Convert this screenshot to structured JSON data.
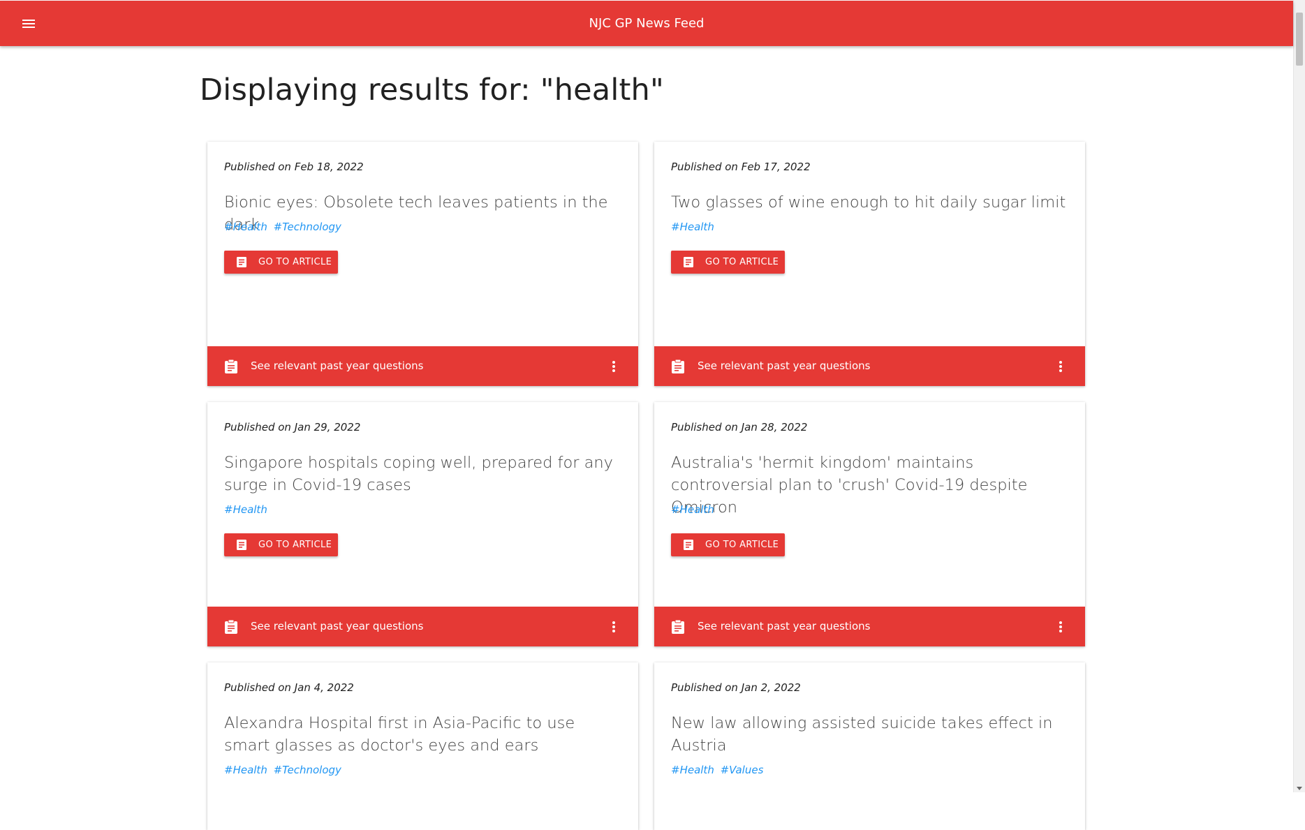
{
  "colors": {
    "primary": "#e53935",
    "tag": "#2196f3",
    "heading": "#212121"
  },
  "appbar": {
    "title": "NJC GP News Feed",
    "menu_icon": "menu-icon"
  },
  "page": {
    "heading": "Displaying results for: \"health\""
  },
  "common": {
    "go_label": "GO TO ARTICLE",
    "footer_label": "See relevant past year questions",
    "article_icon": "article-icon",
    "clipboard_icon": "clipboard-icon",
    "more_icon": "more-vert-icon"
  },
  "articles": [
    {
      "date": "Published on Feb 18, 2022",
      "title": "Bionic eyes: Obsolete tech leaves patients in the dark",
      "tags": [
        "#Health",
        "#Technology"
      ]
    },
    {
      "date": "Published on Feb 17, 2022",
      "title": "Two glasses of wine enough to hit daily sugar limit",
      "tags": [
        "#Health"
      ]
    },
    {
      "date": "Published on Jan 29, 2022",
      "title": "Singapore hospitals coping well, prepared for any surge in Covid-19 cases",
      "tags": [
        "#Health"
      ]
    },
    {
      "date": "Published on Jan 28, 2022",
      "title": "Australia's 'hermit kingdom' maintains controversial plan to 'crush' Covid-19 despite Omicron",
      "tags": [
        "#Health"
      ]
    },
    {
      "date": "Published on Jan 4, 2022",
      "title": "Alexandra Hospital first in Asia-Pacific to use smart glasses as doctor's eyes and ears",
      "tags": [
        "#Health",
        "#Technology"
      ]
    },
    {
      "date": "Published on Jan 2, 2022",
      "title": "New law allowing assisted suicide takes effect in Austria",
      "tags": [
        "#Health",
        "#Values"
      ]
    }
  ]
}
